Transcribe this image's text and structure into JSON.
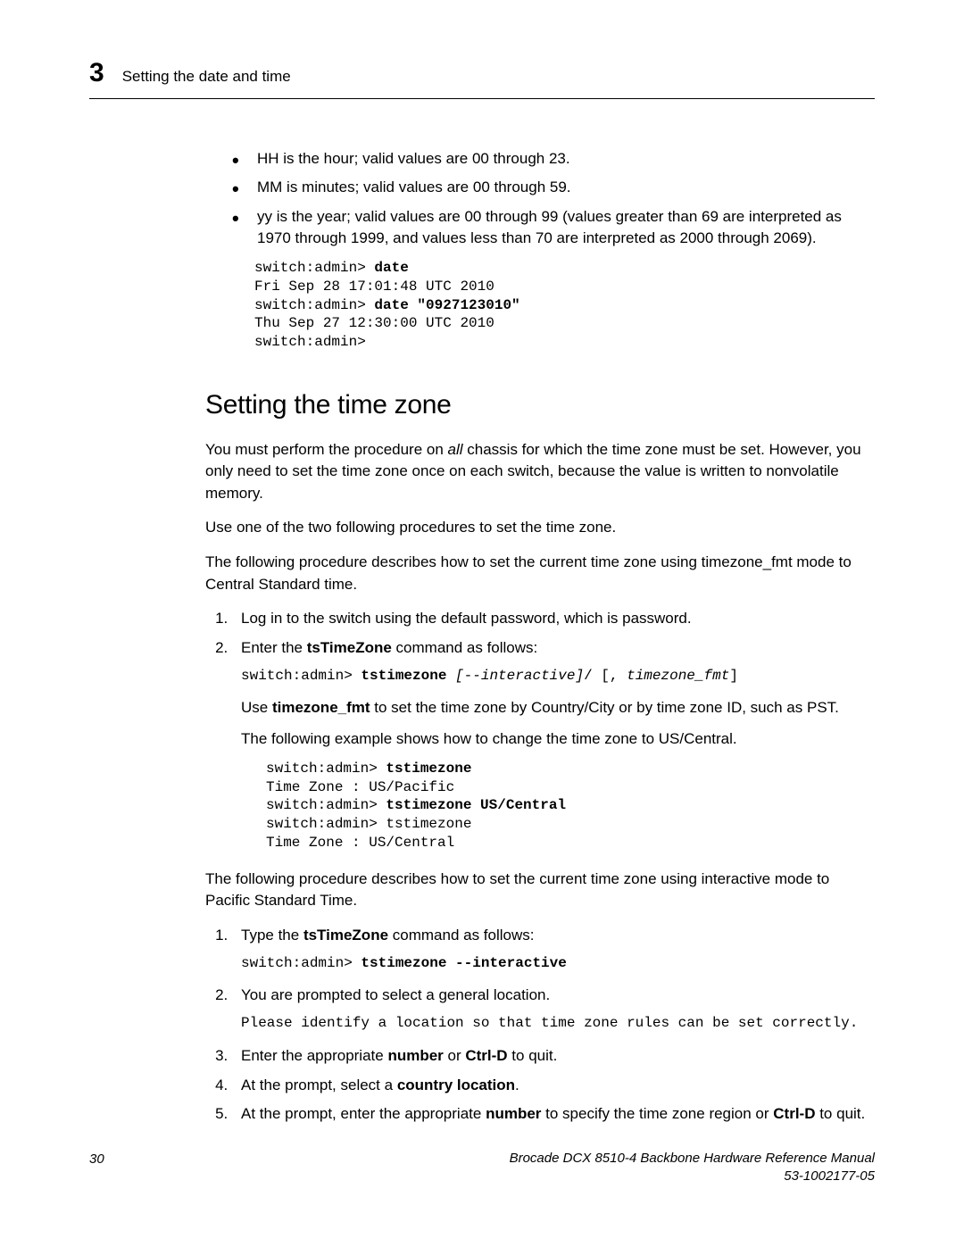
{
  "header": {
    "chapter_num": "3",
    "chapter_title": "Setting the date and time"
  },
  "bullets": {
    "b1": "HH is the hour; valid values are 00 through 23.",
    "b2": "MM is minutes; valid values are 00 through 59.",
    "b3": "yy is the year; valid values are 00 through 99 (values greater than 69 are interpreted as 1970 through 1999, and values less than 70 are interpreted as 2000 through 2069)."
  },
  "code1": {
    "l1a": "switch:admin> ",
    "l1b": "date",
    "l2": "Fri Sep 28 17:01:48 UTC 2010",
    "l3a": "switch:admin> ",
    "l3b": "date \"0927123010\"",
    "l4": "Thu Sep 27 12:30:00 UTC 2010",
    "l5": "switch:admin>"
  },
  "section_heading": "Setting the time zone",
  "para1_a": "You must perform the procedure on ",
  "para1_ital": "all",
  "para1_b": " chassis for which the time zone must be set. However, you only need to set the time zone once on each switch, because the value is written to nonvolatile memory.",
  "para2": "Use one of the two following procedures to set the time zone.",
  "para3": "The following procedure describes how to set the current time zone using timezone_fmt mode to Central Standard time.",
  "stepsA": {
    "s1": "Log in to the switch using the default password, which is password.",
    "s2_a": "Enter the ",
    "s2_bold": "tsTimeZone",
    "s2_b": " command as follows:",
    "s2_code_a": "switch:admin> ",
    "s2_code_b": "tstimezone ",
    "s2_code_c": "[--interactive]",
    "s2_code_d": "/ [, ",
    "s2_code_e": "timezone_fmt",
    "s2_code_f": "]",
    "s2_p1_a": "Use ",
    "s2_p1_bold": "timezone_fmt",
    "s2_p1_b": " to set the time zone by Country/City or by time zone ID, such as PST.",
    "s2_p2": "The following example shows how to change the time zone to US/Central.",
    "s2_code2_l1a": "switch:admin> ",
    "s2_code2_l1b": "tstimezone",
    "s2_code2_l2": "Time Zone : US/Pacific",
    "s2_code2_l3a": "switch:admin> ",
    "s2_code2_l3b": "tstimezone US/Central",
    "s2_code2_l4": "switch:admin> tstimezone",
    "s2_code2_l5": "Time Zone : US/Central"
  },
  "para4": "The following procedure describes how to set the current time zone using interactive mode to Pacific Standard Time.",
  "stepsB": {
    "s1_a": "Type the ",
    "s1_bold": "tsTimeZone",
    "s1_b": " command as follows:",
    "s1_code_a": "switch:admin> ",
    "s1_code_b": "tstimezone --interactive",
    "s2": "You are prompted to select a general location.",
    "s2_code": "Please identify a location so that time zone rules can be set correctly.",
    "s3_a": "Enter the appropriate ",
    "s3_bold1": "number",
    "s3_b": " or ",
    "s3_bold2": "Ctrl-D",
    "s3_c": " to quit.",
    "s4_a": "At the prompt, select a ",
    "s4_bold": "country location",
    "s4_b": ".",
    "s5_a": "At the prompt, enter the appropriate ",
    "s5_bold1": "number",
    "s5_b": " to specify the time zone region or ",
    "s5_bold2": "Ctrl-D",
    "s5_c": " to quit."
  },
  "footer": {
    "page_num": "30",
    "title": "Brocade DCX 8510-4 Backbone Hardware Reference Manual",
    "docnum": "53-1002177-05"
  }
}
